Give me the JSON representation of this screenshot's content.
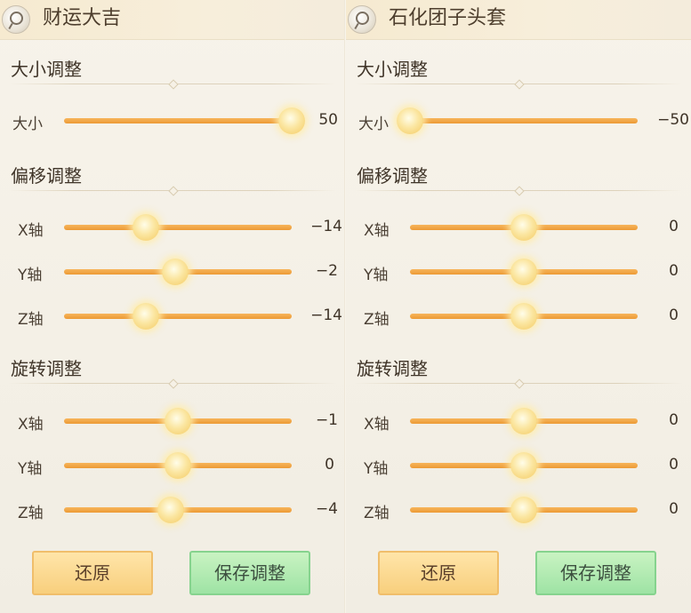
{
  "panels": [
    {
      "title": "财运大吉",
      "size_section": {
        "title": "大小调整",
        "label": "大小",
        "value": "50",
        "level": 1.0
      },
      "offset_section": {
        "title": "偏移调整",
        "rows": [
          {
            "label": "X轴",
            "value": "−14",
            "level": 0.36
          },
          {
            "label": "Y轴",
            "value": "−2",
            "level": 0.49
          },
          {
            "label": "Z轴",
            "value": "−14",
            "level": 0.36
          }
        ]
      },
      "rotate_section": {
        "title": "旋转调整",
        "rows": [
          {
            "label": "X轴",
            "value": "−1",
            "level": 0.5
          },
          {
            "label": "Y轴",
            "value": "0",
            "level": 0.5
          },
          {
            "label": "Z轴",
            "value": "−4",
            "level": 0.47
          }
        ]
      },
      "reset_label": "还原",
      "save_label": "保存调整"
    },
    {
      "title": "石化团子头套",
      "size_section": {
        "title": "大小调整",
        "label": "大小",
        "value": "−50",
        "level": 0.0
      },
      "offset_section": {
        "title": "偏移调整",
        "rows": [
          {
            "label": "X轴",
            "value": "0",
            "level": 0.5
          },
          {
            "label": "Y轴",
            "value": "0",
            "level": 0.5
          },
          {
            "label": "Z轴",
            "value": "0",
            "level": 0.5
          }
        ]
      },
      "rotate_section": {
        "title": "旋转调整",
        "rows": [
          {
            "label": "X轴",
            "value": "0",
            "level": 0.5
          },
          {
            "label": "Y轴",
            "value": "0",
            "level": 0.5
          },
          {
            "label": "Z轴",
            "value": "0",
            "level": 0.5
          }
        ]
      },
      "reset_label": "还原",
      "save_label": "保存调整"
    }
  ],
  "icons": {
    "header": "search-magnifier-icon"
  },
  "colors": {
    "track": "#ec9a35",
    "thumb": "#f4ca62",
    "reset_button": "#f8cf7d",
    "save_button": "#9ee3a4"
  }
}
